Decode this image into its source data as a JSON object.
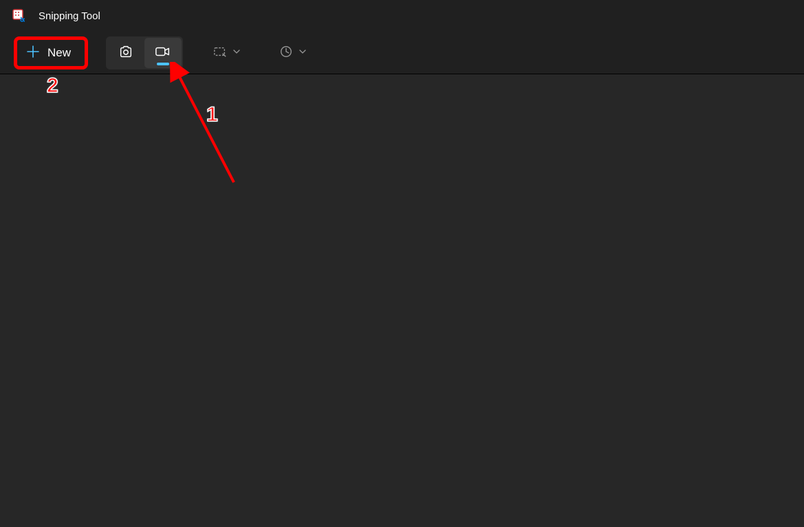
{
  "titlebar": {
    "app_name": "Snipping Tool"
  },
  "toolbar": {
    "new_label": "New"
  },
  "annotations": {
    "label_1": "1",
    "label_2": "2"
  }
}
